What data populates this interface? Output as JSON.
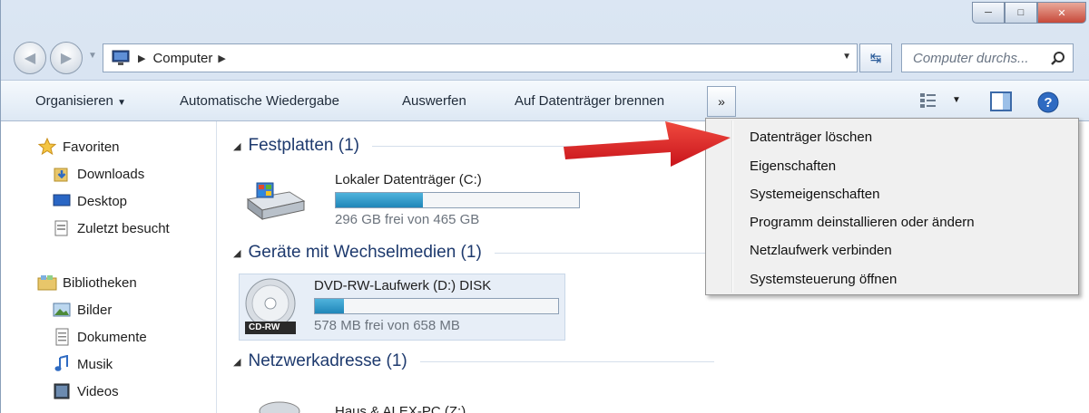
{
  "address": {
    "segment": "Computer"
  },
  "search": {
    "placeholder": "Computer durchs..."
  },
  "toolbar": {
    "organize": "Organisieren",
    "autoplay": "Automatische Wiedergabe",
    "eject": "Auswerfen",
    "burn": "Auf Datenträger brennen",
    "more": "»"
  },
  "navpane": {
    "favorites": "Favoriten",
    "downloads": "Downloads",
    "desktop": "Desktop",
    "recent": "Zuletzt besucht",
    "libraries": "Bibliotheken",
    "pictures": "Bilder",
    "documents": "Dokumente",
    "music": "Musik",
    "videos": "Videos"
  },
  "groups": {
    "harddisks": "Festplatten (1)",
    "removable": "Geräte mit Wechselmedien (1)",
    "network": "Netzwerkadresse (1)"
  },
  "drives": {
    "c": {
      "name": "Lokaler Datenträger (C:)",
      "free": "296 GB frei von 465 GB",
      "used_fraction": 0.36
    },
    "d": {
      "name": "DVD-RW-Laufwerk (D:) DISK",
      "free": "578 MB frei von 658 MB",
      "used_fraction": 0.12,
      "badge": "CD-RW"
    },
    "z": {
      "name": "Haus & ALEX-PC (Z:)"
    }
  },
  "menu": {
    "items": [
      "Datenträger löschen",
      "Eigenschaften",
      "Systemeigenschaften",
      "Programm deinstallieren oder ändern",
      "Netzlaufwerk verbinden",
      "Systemsteuerung öffnen"
    ]
  },
  "colors": {
    "accent": "#1f86b9",
    "arrow": "#e3262b",
    "group_header": "#1e3a6e"
  }
}
